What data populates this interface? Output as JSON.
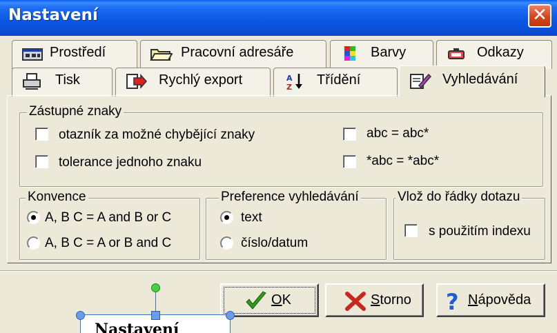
{
  "window": {
    "title": "Nastavení",
    "close_glyph": "✕"
  },
  "tabs_row1": [
    {
      "label": "Prostředí",
      "icon": "environment-icon"
    },
    {
      "label": "Pracovní adresáře",
      "icon": "folder-icon"
    },
    {
      "label": "Barvy",
      "icon": "color-palette-icon"
    },
    {
      "label": "Odkazy",
      "icon": "links-icon"
    }
  ],
  "tabs_row2": [
    {
      "label": "Tisk",
      "icon": "printer-icon"
    },
    {
      "label": "Rychlý export",
      "icon": "export-icon"
    },
    {
      "label": "Třídění",
      "icon": "sort-az-icon"
    },
    {
      "label": "Vyhledávání",
      "icon": "search-settings-icon",
      "active": true
    }
  ],
  "wildcards": {
    "legend": "Zástupné znaky",
    "options": [
      {
        "label": "otazník za možné chybějící znaky",
        "checked": false
      },
      {
        "label": "tolerance jednoho znaku",
        "checked": false
      },
      {
        "label": "abc = abc*",
        "checked": false
      },
      {
        "label": "*abc = *abc*",
        "checked": false
      }
    ]
  },
  "convention": {
    "legend": "Konvence",
    "options": [
      {
        "label": "A, B C = A and B or C",
        "selected": true
      },
      {
        "label": "A, B C = A or B and C",
        "selected": false
      }
    ]
  },
  "search_preference": {
    "legend": "Preference vyhledávání",
    "options": [
      {
        "label": "text",
        "selected": true
      },
      {
        "label": "číslo/datum",
        "selected": false
      }
    ]
  },
  "insert_query": {
    "legend": "Vlož do řádky dotazu",
    "option": {
      "label": "s použitím indexu",
      "checked": false
    }
  },
  "buttons": {
    "ok": {
      "mnemonic": "O",
      "rest": "K",
      "icon": "checkmark-icon",
      "color": "#2e9b1f"
    },
    "cancel": {
      "mnemonic": "S",
      "rest": "torno",
      "icon": "x-cancel-icon",
      "color": "#c8281e"
    },
    "help": {
      "mnemonic": "N",
      "rest": "ápověda",
      "icon": "question-mark-icon",
      "color": "#1d5fd0"
    }
  },
  "overlay": {
    "title": "Nastavení"
  }
}
